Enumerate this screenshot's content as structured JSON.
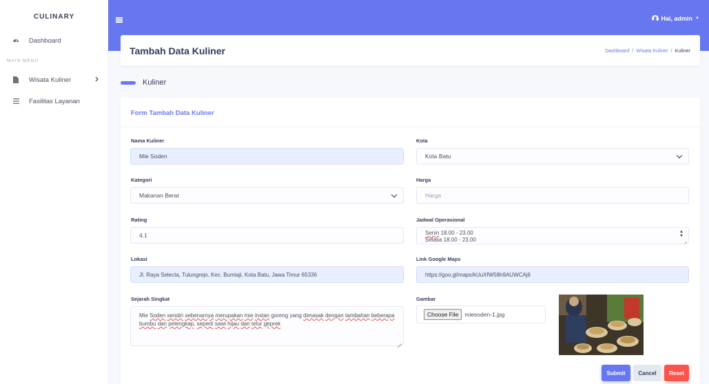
{
  "sidebar": {
    "brand": "CULINARY",
    "dashboard_label": "Dashboard",
    "menu_header": "MAIN MENU",
    "items": [
      {
        "label": "Wisata Kuliner",
        "icon": "file-icon"
      },
      {
        "label": "Fasilitas Layanan",
        "icon": "list-icon"
      }
    ]
  },
  "topbar": {
    "user_label": "Hai, admin"
  },
  "header": {
    "title": "Tambah Data Kuliner",
    "breadcrumb": [
      "Dashboard",
      "Wisata Kuliner",
      "Kuliner"
    ],
    "separator": "/"
  },
  "section": {
    "subtitle": "Kuliner"
  },
  "form": {
    "title": "Form Tambah Data Kuliner",
    "nama": {
      "label": "Nama Kuliner",
      "value": "Mie Soden"
    },
    "kota": {
      "label": "Kota",
      "value": "Kota Batu"
    },
    "kategori": {
      "label": "Kategori",
      "value": "Makanan Berat"
    },
    "harga": {
      "label": "Harga",
      "placeholder": "Harga"
    },
    "rating": {
      "label": "Rating",
      "value": "4.1"
    },
    "jadwal": {
      "label": "Jadwal Operasional",
      "line1_day": "Senin",
      "line1_time": " 18.00 - 23.00",
      "line2": "Selasa 18.00 - 23.00"
    },
    "lokasi": {
      "label": "Lokasi",
      "value": "Jl. Raya Selecta, Tulungrejo, Kec. Bumiaji, Kota Batu, Jawa Timur 65336"
    },
    "maps": {
      "label": "Link Google Maps",
      "value": "https://goo.gl/maps/kUuXfW58h9AUWCAj6"
    },
    "sejarah": {
      "label": "Sejarah Singkat",
      "segments": [
        {
          "t": "Mie ",
          "u": false
        },
        {
          "t": "Soden",
          "u": true
        },
        {
          "t": " ",
          "u": false
        },
        {
          "t": "sendiri",
          "u": true
        },
        {
          "t": " ",
          "u": false
        },
        {
          "t": "sebenarnya",
          "u": true
        },
        {
          "t": " ",
          "u": false
        },
        {
          "t": "merupakan",
          "u": true
        },
        {
          "t": " ",
          "u": false
        },
        {
          "t": "mie",
          "u": true
        },
        {
          "t": " ",
          "u": false
        },
        {
          "t": "instan",
          "u": true
        },
        {
          "t": " goreng yang ",
          "u": false
        },
        {
          "t": "dimasak",
          "u": true
        },
        {
          "t": " ",
          "u": false
        },
        {
          "t": "dengan",
          "u": true
        },
        {
          "t": " ",
          "u": false
        },
        {
          "t": "tambahan",
          "u": true
        },
        {
          "t": " ",
          "u": false
        },
        {
          "t": "beberapa",
          "u": true
        },
        {
          "t": " ",
          "u": false
        },
        {
          "t": "bumbu",
          "u": true
        },
        {
          "t": " ",
          "u": false
        },
        {
          "t": "dan",
          "u": true
        },
        {
          "t": " ",
          "u": false
        },
        {
          "t": "pelengkap",
          "u": true
        },
        {
          "t": ", ",
          "u": false
        },
        {
          "t": "seperti",
          "u": true
        },
        {
          "t": " ",
          "u": false
        },
        {
          "t": "sawi",
          "u": true
        },
        {
          "t": " ",
          "u": false
        },
        {
          "t": "hijau",
          "u": true
        },
        {
          "t": " ",
          "u": false
        },
        {
          "t": "dan",
          "u": true
        },
        {
          "t": " ",
          "u": false
        },
        {
          "t": "telur",
          "u": true
        },
        {
          "t": " ",
          "u": false
        },
        {
          "t": "geprek",
          "u": true
        }
      ]
    },
    "gambar": {
      "label": "Gambar",
      "button": "Choose File",
      "filename": "miesoden-1.jpg"
    },
    "buttons": {
      "submit": "Submit",
      "cancel": "Cancel",
      "reset": "Reset"
    }
  },
  "colors": {
    "primary": "#6777ef",
    "danger": "#fc544b",
    "light": "#e3eaef"
  }
}
